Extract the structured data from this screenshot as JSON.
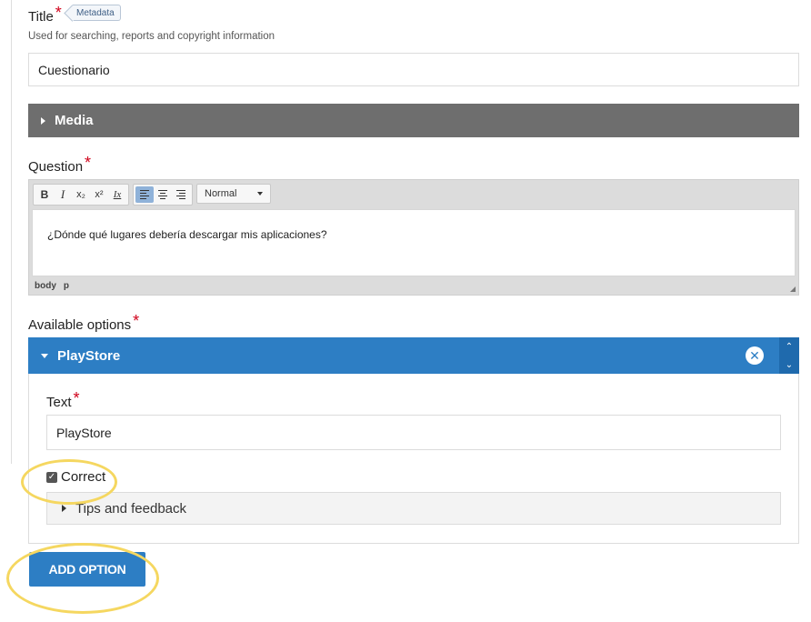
{
  "title_field": {
    "label": "Title",
    "required_mark": "*",
    "metadata_tag": "Metadata",
    "hint": "Used for searching, reports and copyright information",
    "value": "Cuestionario"
  },
  "media": {
    "label": "Media"
  },
  "question_field": {
    "label": "Question",
    "required_mark": "*",
    "toolbar": {
      "bold": "B",
      "italic": "I",
      "subscript": "x₂",
      "superscript": "x²",
      "remove_format": "Ix",
      "format_select": "Normal"
    },
    "content": "¿Dónde qué lugares debería descargar mis aplicaciones?",
    "path": [
      "body",
      "p"
    ]
  },
  "options_field": {
    "label": "Available options",
    "required_mark": "*",
    "option": {
      "title": "PlayStore",
      "text_label": "Text",
      "required_mark": "*",
      "text_value": "PlayStore",
      "correct_label": "Correct",
      "correct_checked": true,
      "feedback_label": "Tips and feedback"
    }
  },
  "add_option_label": "ADD OPTION",
  "colors": {
    "accent": "#2d7ec4",
    "media_bar": "#6e6e6e",
    "required": "#d0021b",
    "highlight_annotation": "#f5d760"
  }
}
